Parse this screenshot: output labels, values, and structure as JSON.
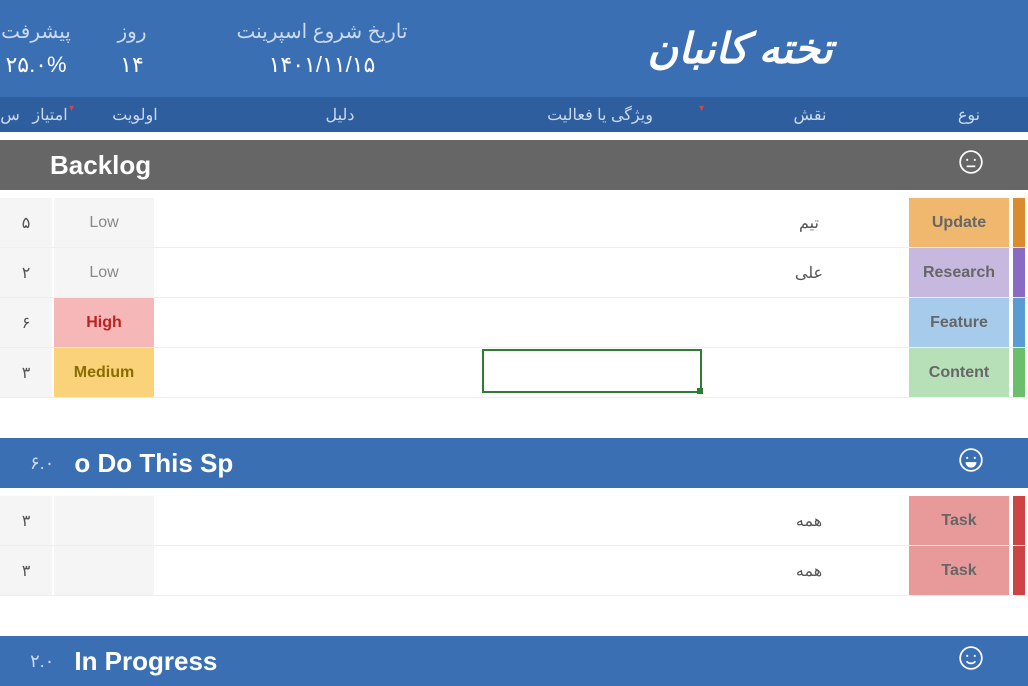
{
  "header": {
    "title": "تخته کانبان",
    "sprint_date_label": "تاریخ شروع اسپرینت",
    "sprint_date_value": "۱۴۰۱/۱۱/۱۵",
    "days_label": "روز",
    "days_value": "۱۴",
    "progress_label": "پیشرفت",
    "progress_value": "۲۵.۰%"
  },
  "columns": {
    "type": "نوع",
    "role": "نقش",
    "feature": "ویژگی یا فعالیت",
    "reason": "دلیل",
    "priority": "اولویت",
    "score": "امتیاز",
    "s": "س"
  },
  "sections": {
    "backlog": {
      "title": "Backlog",
      "value": ""
    },
    "todo": {
      "title": "o Do This Sp",
      "value": "۶.۰"
    },
    "inprogress": {
      "title": "In Progress",
      "value": "۲.۰"
    }
  },
  "backlog_rows": [
    {
      "type": "Update",
      "role": "تیم",
      "feature": "",
      "reason": "",
      "priority": "Low",
      "score": "۵"
    },
    {
      "type": "Research",
      "role": "علی",
      "feature": "",
      "reason": "",
      "priority": "Low",
      "score": "۲"
    },
    {
      "type": "Feature",
      "role": "",
      "feature": "",
      "reason": "",
      "priority": "High",
      "score": "۶"
    },
    {
      "type": "Content",
      "role": "",
      "feature": "",
      "reason": "",
      "priority": "Medium",
      "score": "۳"
    }
  ],
  "todo_rows": [
    {
      "type": "Task",
      "role": "همه",
      "feature": "",
      "reason": "",
      "priority": "",
      "score": "۳"
    },
    {
      "type": "Task",
      "role": "همه",
      "feature": "",
      "reason": "",
      "priority": "",
      "score": "۳"
    }
  ]
}
